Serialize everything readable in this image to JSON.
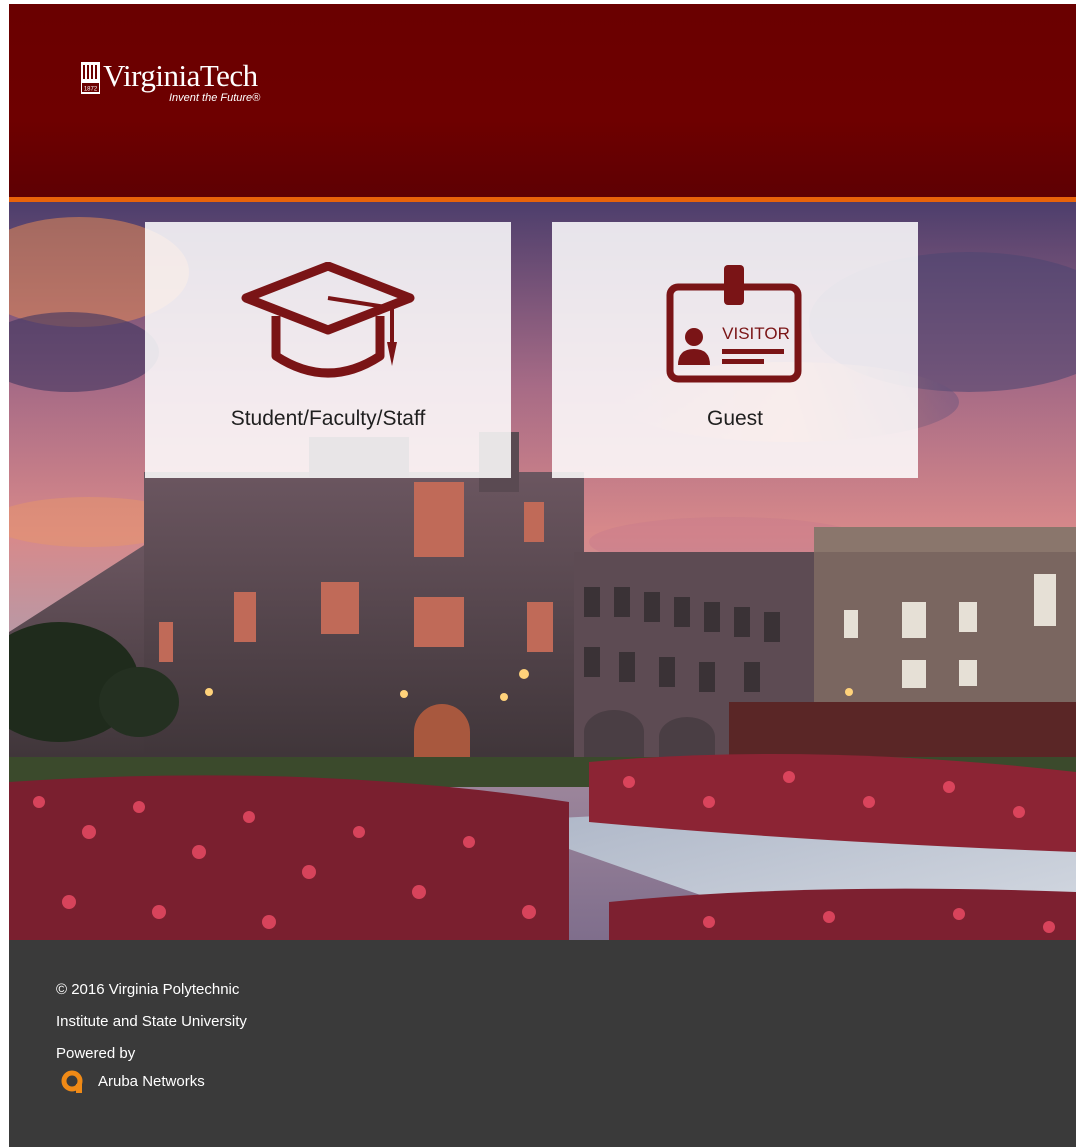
{
  "header": {
    "brand_name": "VirginiaTech",
    "tagline": "Invent the Future®",
    "logo_year": "1872",
    "colors": {
      "maroon": "#6a0000",
      "accent": "#e8630a"
    }
  },
  "options": [
    {
      "label": "Student/Faculty/Staff",
      "icon": "graduation-cap-icon"
    },
    {
      "label": "Guest",
      "icon": "visitor-badge-icon",
      "badge_text": "VISITOR"
    }
  ],
  "footer": {
    "copyright_line1": "© 2016 Virginia Polytechnic",
    "copyright_line2": "Institute and State University",
    "powered_by": "Powered by",
    "vendor": "Aruba Networks",
    "colors": {
      "background": "#3a3a3a",
      "vendor_accent": "#f08a16"
    }
  }
}
